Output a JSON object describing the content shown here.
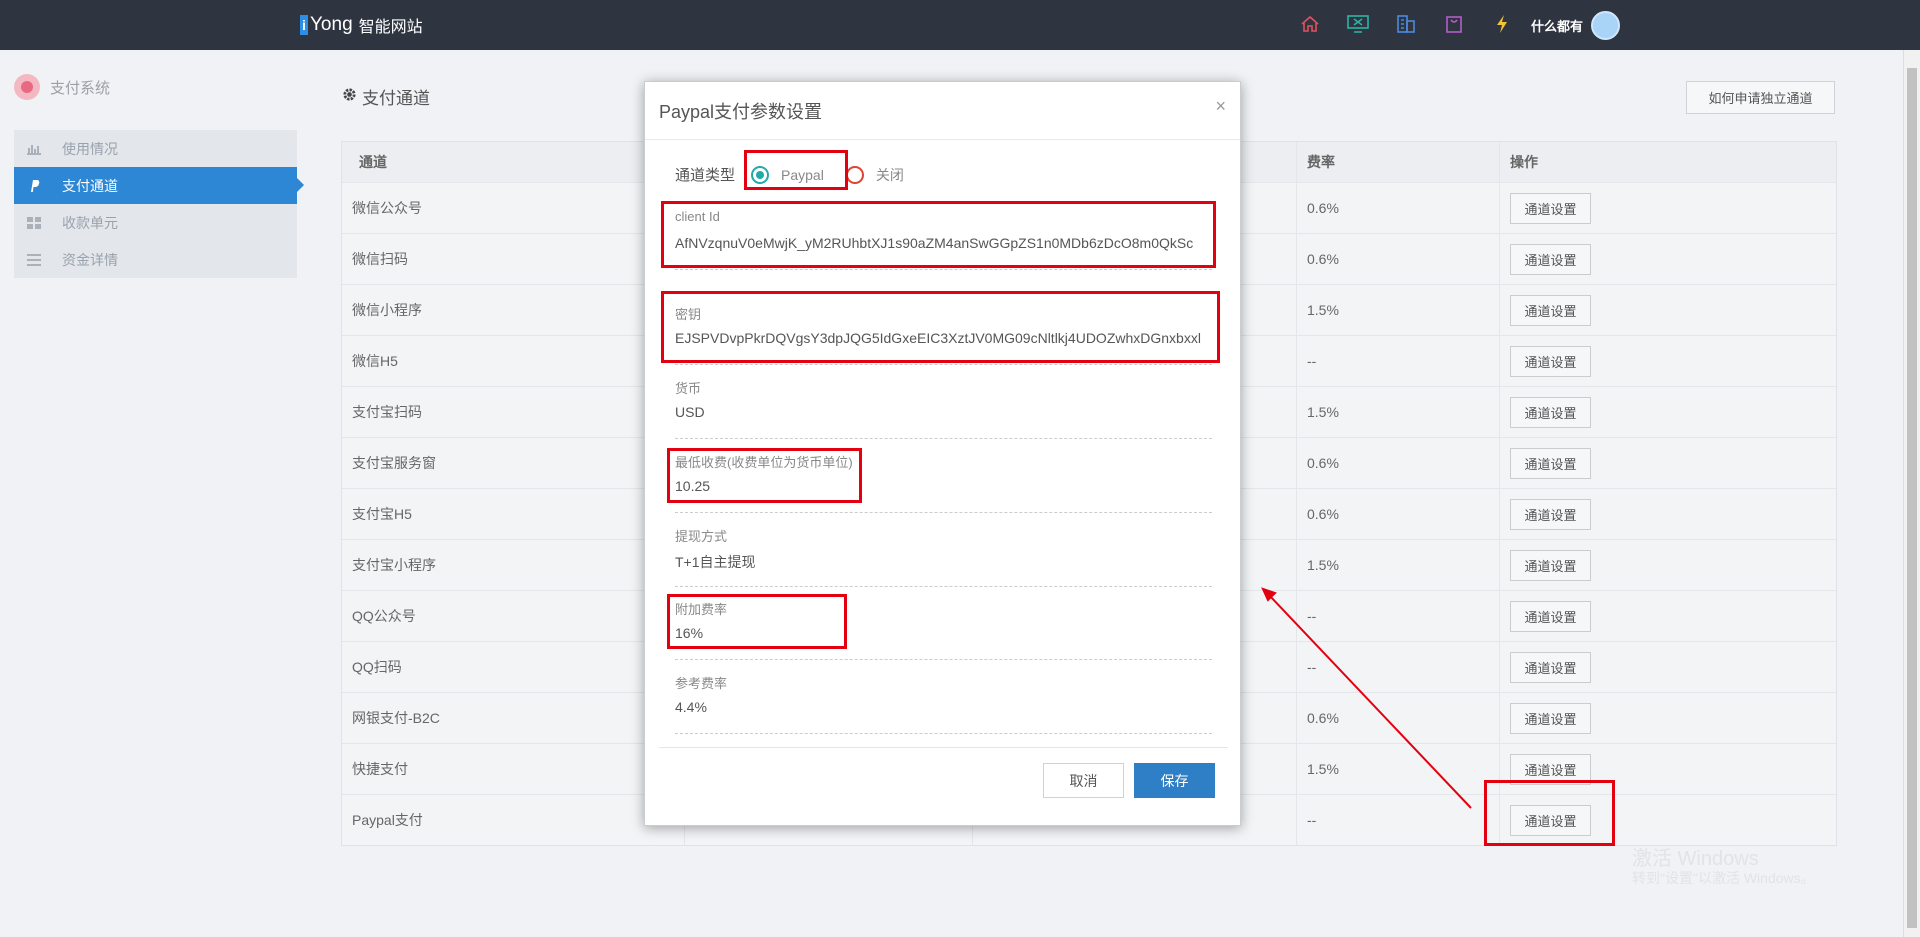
{
  "brand": {
    "logo_i": "i",
    "logo_rest": "Yong",
    "name": "智能网站"
  },
  "topbar": {
    "icons": [
      "home-icon",
      "monitor-icon",
      "building-icon",
      "bag-icon",
      "bolt-icon"
    ],
    "username": "什么都有"
  },
  "sidebar": {
    "system_title": "支付系统",
    "items": [
      {
        "label": "使用情况",
        "icon": "chart-icon",
        "active": false
      },
      {
        "label": "支付通道",
        "icon": "paypal-icon",
        "active": true
      },
      {
        "label": "收款单元",
        "icon": "grid-icon",
        "active": false
      },
      {
        "label": "资金详情",
        "icon": "list-icon",
        "active": false
      }
    ]
  },
  "page": {
    "title": "支付通道",
    "apply_button": "如何申请独立通道"
  },
  "table": {
    "headers": [
      "通道",
      "",
      "",
      "费率",
      "操作"
    ],
    "button_label": "通道设置",
    "rows": [
      {
        "name": "微信公众号",
        "rate": "0.6%"
      },
      {
        "name": "微信扫码",
        "rate": "0.6%"
      },
      {
        "name": "微信小程序",
        "rate": "1.5%"
      },
      {
        "name": "微信H5",
        "rate": "--"
      },
      {
        "name": "支付宝扫码",
        "rate": "1.5%"
      },
      {
        "name": "支付宝服务窗",
        "rate": "0.6%"
      },
      {
        "name": "支付宝H5",
        "rate": "0.6%"
      },
      {
        "name": "支付宝小程序",
        "rate": "1.5%"
      },
      {
        "name": "QQ公众号",
        "rate": "--"
      },
      {
        "name": "QQ扫码",
        "rate": "--"
      },
      {
        "name": "网银支付-B2C",
        "rate": "0.6%"
      },
      {
        "name": "快捷支付",
        "rate": "1.5%"
      },
      {
        "name": "Paypal支付",
        "rate": "--"
      }
    ]
  },
  "modal": {
    "title": "Paypal支付参数设置",
    "close": "×",
    "channel_type_label": "通道类型",
    "options": [
      {
        "label": "Paypal",
        "checked": true
      },
      {
        "label": "关闭",
        "checked": false
      }
    ],
    "fields": {
      "client_id": {
        "label": "client Id",
        "value": "AfNVzqnuV0eMwjK_yM2RUhbtXJ1s90aZM4anSwGGpZS1n0MDb6zDcO8m0QkSc"
      },
      "secret": {
        "label": "密钥",
        "value": "EJSPVDvpPkrDQVgsY3dpJQG5IdGxeEIC3XztJV0MG09cNltlkj4UDOZwhxDGnxbxxl"
      },
      "currency": {
        "label": "货币",
        "value": "USD"
      },
      "min_fee": {
        "label": "最低收费(收费单位为货币单位)",
        "value": "10.25"
      },
      "withdraw": {
        "label": "提现方式",
        "value": "T+1自主提现"
      },
      "extra_rate": {
        "label": "附加费率",
        "value": "16%"
      },
      "ref_rate": {
        "label": "参考费率",
        "value": "4.4%"
      }
    },
    "cancel": "取消",
    "save": "保存"
  },
  "watermark": {
    "line1": "激活 Windows",
    "line2": "转到\"设置\"以激活 Windows。"
  },
  "colors": {
    "topbar": "#2e3440",
    "accent": "#2d87d4",
    "annotation": "#e3000f"
  }
}
